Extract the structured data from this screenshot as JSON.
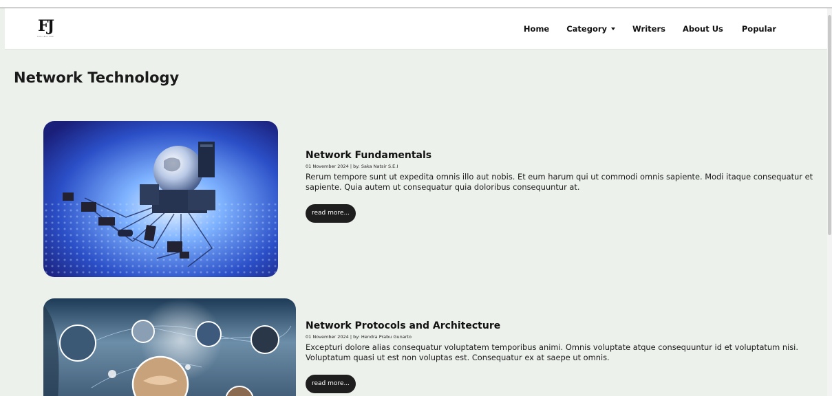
{
  "brand": {
    "logo_mark": "FJ",
    "logo_tagline": "COLLECTION"
  },
  "nav": {
    "home": "Home",
    "category": "Category",
    "writers": "Writers",
    "about": "About Us",
    "popular": "Popular"
  },
  "page": {
    "title": "Network Technology"
  },
  "articles": [
    {
      "title": "Network Fundamentals",
      "meta": "01 November 2024 | by: Saka Natsir S.E.I",
      "excerpt": "Rerum tempore sunt ut expedita omnis illo aut nobis. Et eum harum qui ut commodi omnis sapiente. Modi itaque consequatur et sapiente. Quia autem ut consequatur quia doloribus consequuntur at.",
      "button": "read more..."
    },
    {
      "title": "Network Protocols and Architecture",
      "meta": "01 November 2024 | by: Hendra Prabu Gunarto",
      "excerpt": "Excepturi dolore alias consequatur voluptatem temporibus animi. Omnis voluptate atque consequuntur id et voluptatum nisi. Voluptatum quasi ut est non voluptas est. Consequatur ex at saepe ut omnis.",
      "button": "read more..."
    }
  ],
  "colors": {
    "background": "#edf1ec",
    "navbar": "#ffffff",
    "button": "#1e1e1e"
  }
}
